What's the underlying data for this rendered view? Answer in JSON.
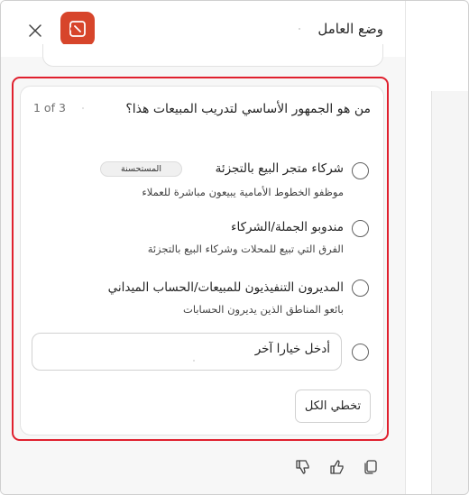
{
  "header": {
    "title": "وضع العامل",
    "close_icon": "close-icon",
    "app_icon": "office-agent-icon",
    "brand_color": "#d7452b"
  },
  "question_card": {
    "question": "من هو الجمهور الأساسي لتدريب المبيعات هذا؟",
    "counter": "1 of 3",
    "options": [
      {
        "title": "شركاء متجر البيع بالتجزئة",
        "description": "موظفو الخطوط الأمامية يبيعون مباشرة للعملاء",
        "badge": "المستحسنة"
      },
      {
        "title": "مندوبو الجملة/الشركاء",
        "description": "الفرق التي تبيع للمحلات وشركاء البيع بالتجزئة"
      },
      {
        "title": "المديرون التنفيذيون للمبيعات/الحساب الميداني",
        "description": "بائعو المناطق الذين يديرون الحسابات"
      }
    ],
    "other_input": "أدخل خيارا آخر",
    "skip_button": "تخطي الكل",
    "highlight_color": "#e0202e"
  },
  "footer": {
    "icons": [
      "thumbs-down-icon",
      "thumbs-up-icon",
      "copy-icon"
    ]
  }
}
